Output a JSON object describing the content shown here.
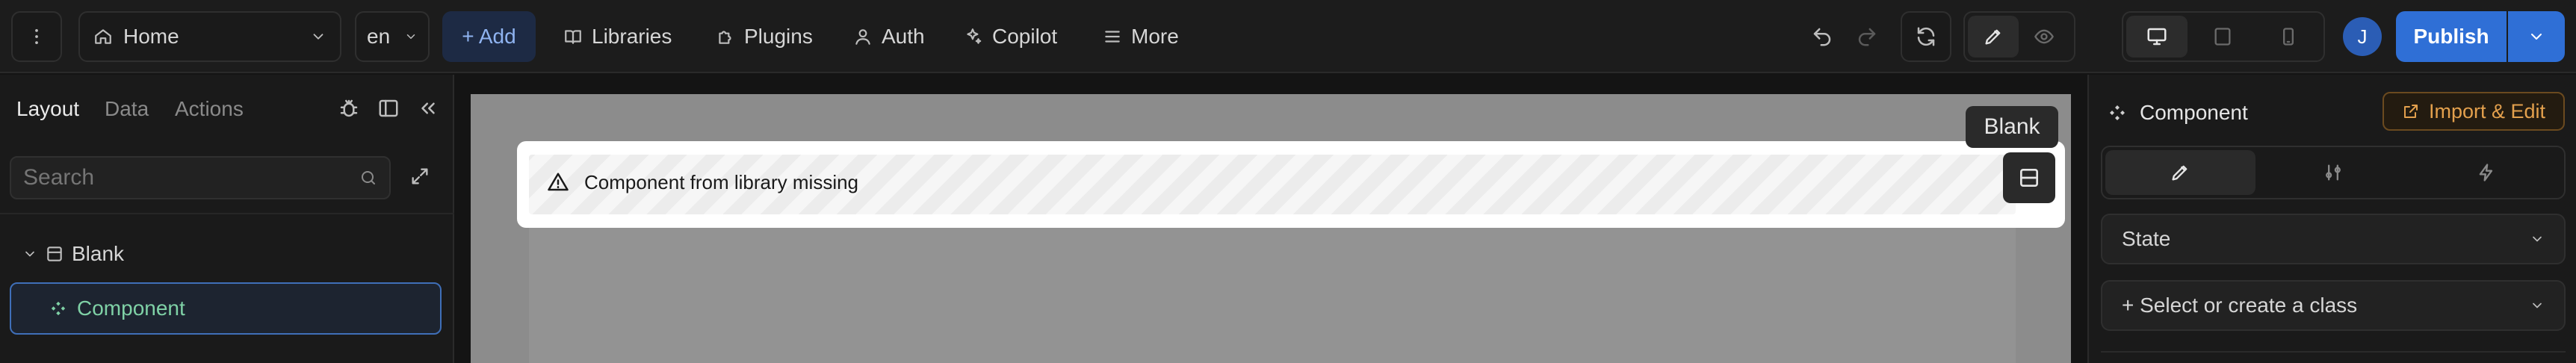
{
  "colors": {
    "accent": "#2f6fd6",
    "warning": "#e3a04d",
    "selected_text": "#7fd1a6",
    "avatar": "#2b5db5"
  },
  "topbar": {
    "menu_icon": "more-vertical-icon",
    "page_select": "Home",
    "locale_select": "en",
    "add_label": "+ Add",
    "libraries_label": "Libraries",
    "plugins_label": "Plugins",
    "auth_label": "Auth",
    "copilot_label": "Copilot",
    "more_label": "More",
    "avatar_initial": "J",
    "publish_label": "Publish"
  },
  "left_panel": {
    "tabs": [
      "Layout",
      "Data",
      "Actions"
    ],
    "search_placeholder": "Search",
    "tree": [
      {
        "label": "Blank",
        "expanded": true
      },
      {
        "label": "Component",
        "selected": true
      }
    ]
  },
  "canvas": {
    "tooltip": "Blank",
    "missing_message": "Component from library missing"
  },
  "right_panel": {
    "title": "Component",
    "import_edit_label": "Import & Edit",
    "state_label": "State",
    "class_placeholder": "+ Select or create a class"
  }
}
